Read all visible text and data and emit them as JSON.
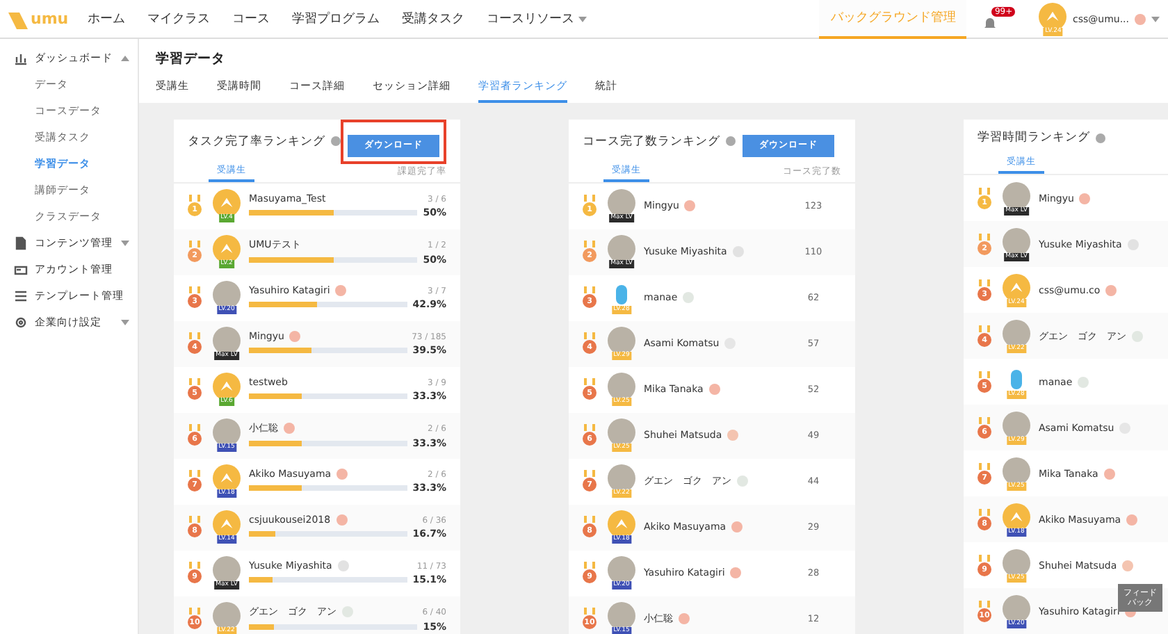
{
  "header": {
    "logo": "umu",
    "nav": [
      "ホーム",
      "マイクラス",
      "コース",
      "学習プログラム",
      "受講タスク",
      "コースリソース"
    ],
    "admin": {
      "label": "バックグラウンド管理",
      "selected": true
    },
    "notifications": "99+",
    "user": {
      "level": "LV.24",
      "name": "css@umu...",
      "status": {
        "color": "#f4b5a5"
      }
    }
  },
  "sidebar": {
    "items": [
      {
        "label": "ダッシュボード",
        "kind": "chart",
        "expanded": true,
        "children": [
          {
            "label": "データ",
            "selected": false
          },
          {
            "label": "コースデータ",
            "selected": false
          },
          {
            "label": "受講タスク",
            "selected": false
          },
          {
            "label": "学習データ",
            "selected": true
          },
          {
            "label": "講師データ",
            "selected": false
          },
          {
            "label": "クラスデータ",
            "selected": false
          }
        ]
      },
      {
        "label": "コンテンツ管理",
        "kind": "doc",
        "expanded": false
      },
      {
        "label": "アカウント管理",
        "kind": "card"
      },
      {
        "label": "テンプレート管理",
        "kind": "list"
      },
      {
        "label": "企業向け設定",
        "kind": "gear",
        "expanded": false
      }
    ]
  },
  "page_title": "学習データ",
  "tabs": [
    {
      "label": "受講生",
      "selected": false
    },
    {
      "label": "受講時間",
      "selected": false
    },
    {
      "label": "コース詳細",
      "selected": false
    },
    {
      "label": "セッション詳細",
      "selected": false
    },
    {
      "label": "学習者ランキング",
      "selected": true
    },
    {
      "label": "統計",
      "selected": false
    }
  ],
  "cards": [
    {
      "kind": "progress",
      "title": "タスク完了率ランキング",
      "download": "ダウンロード",
      "highlighted": true,
      "tab": "受講生",
      "column": "課題完了率",
      "rows": [
        {
          "rank": "1",
          "kind": "logo",
          "badge": {
            "label": "LV.4",
            "color": "#5aa832"
          },
          "name": "Masuyama_Test",
          "fraction": "3 / 6",
          "level": 0.5,
          "percent": "50%"
        },
        {
          "rank": "2",
          "kind": "logo",
          "badge": {
            "label": "LV.2",
            "color": "#5aa832"
          },
          "name": "UMUテスト",
          "fraction": "1 / 2",
          "level": 0.5,
          "percent": "50%"
        },
        {
          "rank": "3",
          "kind": "photo",
          "badge": {
            "label": "LV.20",
            "color": "#3f51b5"
          },
          "name": "Yasuhiro Katagiri",
          "status": {
            "color": "#f4b5a5"
          },
          "fraction": "3 / 7",
          "level": 0.429,
          "percent": "42.9%"
        },
        {
          "rank": "4",
          "kind": "photo",
          "badge": {
            "label": "Max LV",
            "color": "#2b2b2b"
          },
          "name": "Mingyu",
          "status": {
            "color": "#f4b5a5"
          },
          "fraction": "73 / 185",
          "level": 0.395,
          "percent": "39.5%"
        },
        {
          "rank": "5",
          "kind": "logo",
          "badge": {
            "label": "LV.6",
            "color": "#5aa832"
          },
          "name": "testweb",
          "fraction": "3 / 9",
          "level": 0.333,
          "percent": "33.3%"
        },
        {
          "rank": "6",
          "kind": "photo",
          "badge": {
            "label": "LV.15",
            "color": "#3f51b5"
          },
          "name": "小仁聡",
          "status": {
            "color": "#f4b5a5"
          },
          "fraction": "2 / 6",
          "level": 0.333,
          "percent": "33.3%"
        },
        {
          "rank": "7",
          "kind": "logo",
          "badge": {
            "label": "LV.18",
            "color": "#3f51b5"
          },
          "name": "Akiko Masuyama",
          "status": {
            "color": "#f4b5a5"
          },
          "fraction": "2 / 6",
          "level": 0.333,
          "percent": "33.3%"
        },
        {
          "rank": "8",
          "kind": "logo",
          "badge": {
            "label": "LV.14",
            "color": "#3f51b5"
          },
          "name": "csjuukousei2018",
          "status": {
            "color": "#f4b5a5"
          },
          "fraction": "6 / 36",
          "level": 0.167,
          "percent": "16.7%"
        },
        {
          "rank": "9",
          "kind": "photo",
          "badge": {
            "label": "Max LV",
            "color": "#2b2b2b"
          },
          "name": "Yusuke Miyashita",
          "status": {
            "color": "#e2e2e2"
          },
          "fraction": "11 / 73",
          "level": 0.151,
          "percent": "15.1%"
        },
        {
          "rank": "10",
          "kind": "photo",
          "badge": {
            "label": "LV.22",
            "color": "#f5b942"
          },
          "name": "グエン　ゴク　アン",
          "status": {
            "color": "#e2e8e2"
          },
          "fraction": "6 / 40",
          "level": 0.15,
          "percent": "15%"
        }
      ]
    },
    {
      "kind": "count",
      "title": "コース完了数ランキング",
      "download": "ダウンロード",
      "highlighted": false,
      "tab": "受講生",
      "column": "コース完了数",
      "rows": [
        {
          "rank": "1",
          "kind": "photo",
          "badge": {
            "label": "Max LV",
            "color": "#2b2b2b"
          },
          "name": "Mingyu",
          "status": {
            "color": "#f4b5a5"
          },
          "count": "123"
        },
        {
          "rank": "2",
          "kind": "photo",
          "badge": {
            "label": "Max LV",
            "color": "#2b2b2b"
          },
          "name": "Yusuke Miyashita",
          "status": {
            "color": "#e2e2e2"
          },
          "count": "110"
        },
        {
          "rank": "3",
          "kind": "mascot",
          "badge": {
            "label": "LV.28",
            "color": "#f5b942"
          },
          "name": "manae",
          "status": {
            "color": "#e2e8e2"
          },
          "count": "62"
        },
        {
          "rank": "4",
          "kind": "photo",
          "badge": {
            "label": "LV.29",
            "color": "#f5b942"
          },
          "name": "Asami Komatsu",
          "status": {
            "color": "#e6e6e6"
          },
          "count": "57"
        },
        {
          "rank": "5",
          "kind": "photo",
          "badge": {
            "label": "LV.25",
            "color": "#f5b942"
          },
          "name": "Mika Tanaka",
          "status": {
            "color": "#f4b5a5"
          },
          "count": "52"
        },
        {
          "rank": "6",
          "kind": "photo",
          "badge": {
            "label": "LV.25",
            "color": "#f5b942"
          },
          "name": "Shuhei Matsuda",
          "status": {
            "color": "#f4c4b0"
          },
          "count": "49"
        },
        {
          "rank": "7",
          "kind": "photo",
          "badge": {
            "label": "LV.22",
            "color": "#f5b942"
          },
          "name": "グエン　ゴク　アン",
          "status": {
            "color": "#e2e8e2"
          },
          "count": "44"
        },
        {
          "rank": "8",
          "kind": "logo",
          "badge": {
            "label": "LV.18",
            "color": "#3f51b5"
          },
          "name": "Akiko Masuyama",
          "status": {
            "color": "#f4b5a5"
          },
          "count": "29"
        },
        {
          "rank": "9",
          "kind": "photo",
          "badge": {
            "label": "LV.20",
            "color": "#3f51b5"
          },
          "name": "Yasuhiro Katagiri",
          "status": {
            "color": "#f4b5a5"
          },
          "count": "28"
        },
        {
          "rank": "10",
          "kind": "photo",
          "badge": {
            "label": "LV.15",
            "color": "#3f51b5"
          },
          "name": "小仁聡",
          "status": {
            "color": "#f4b5a5"
          },
          "count": "12"
        }
      ]
    },
    {
      "kind": "plain",
      "title": "学習時間ランキング",
      "tab": "受講生",
      "rows": [
        {
          "rank": "1",
          "kind": "photo",
          "badge": {
            "label": "Max LV",
            "color": "#2b2b2b"
          },
          "name": "Mingyu",
          "status": {
            "color": "#f4b5a5"
          }
        },
        {
          "rank": "2",
          "kind": "photo",
          "badge": {
            "label": "Max LV",
            "color": "#2b2b2b"
          },
          "name": "Yusuke Miyashita",
          "status": {
            "color": "#e2e2e2"
          }
        },
        {
          "rank": "3",
          "kind": "logo",
          "badge": {
            "label": "LV.24",
            "color": "#f5b942"
          },
          "name": "css@umu.co",
          "status": {
            "color": "#f4b5a5"
          }
        },
        {
          "rank": "4",
          "kind": "photo",
          "badge": {
            "label": "LV.22",
            "color": "#f5b942"
          },
          "name": "グエン　ゴク　アン",
          "status": {
            "color": "#e2e8e2"
          }
        },
        {
          "rank": "5",
          "kind": "mascot",
          "badge": {
            "label": "LV.28",
            "color": "#f5b942"
          },
          "name": "manae",
          "status": {
            "color": "#e2e8e2"
          }
        },
        {
          "rank": "6",
          "kind": "photo",
          "badge": {
            "label": "LV.29",
            "color": "#f5b942"
          },
          "name": "Asami Komatsu",
          "status": {
            "color": "#e6e6e6"
          }
        },
        {
          "rank": "7",
          "kind": "photo",
          "badge": {
            "label": "LV.25",
            "color": "#f5b942"
          },
          "name": "Mika Tanaka",
          "status": {
            "color": "#f4b5a5"
          }
        },
        {
          "rank": "8",
          "kind": "logo",
          "badge": {
            "label": "LV.18",
            "color": "#3f51b5"
          },
          "name": "Akiko Masuyama",
          "status": {
            "color": "#f4b5a5"
          }
        },
        {
          "rank": "9",
          "kind": "photo",
          "badge": {
            "label": "LV.25",
            "color": "#f5b942"
          },
          "name": "Shuhei Matsuda",
          "status": {
            "color": "#f4c4b0"
          }
        },
        {
          "rank": "10",
          "kind": "photo",
          "badge": {
            "label": "LV.20",
            "color": "#3f51b5"
          },
          "name": "Yasuhiro Katagiri",
          "status": {
            "color": "#f4b5a5"
          }
        }
      ]
    }
  ],
  "feedback": [
    "フィード",
    "バック"
  ]
}
